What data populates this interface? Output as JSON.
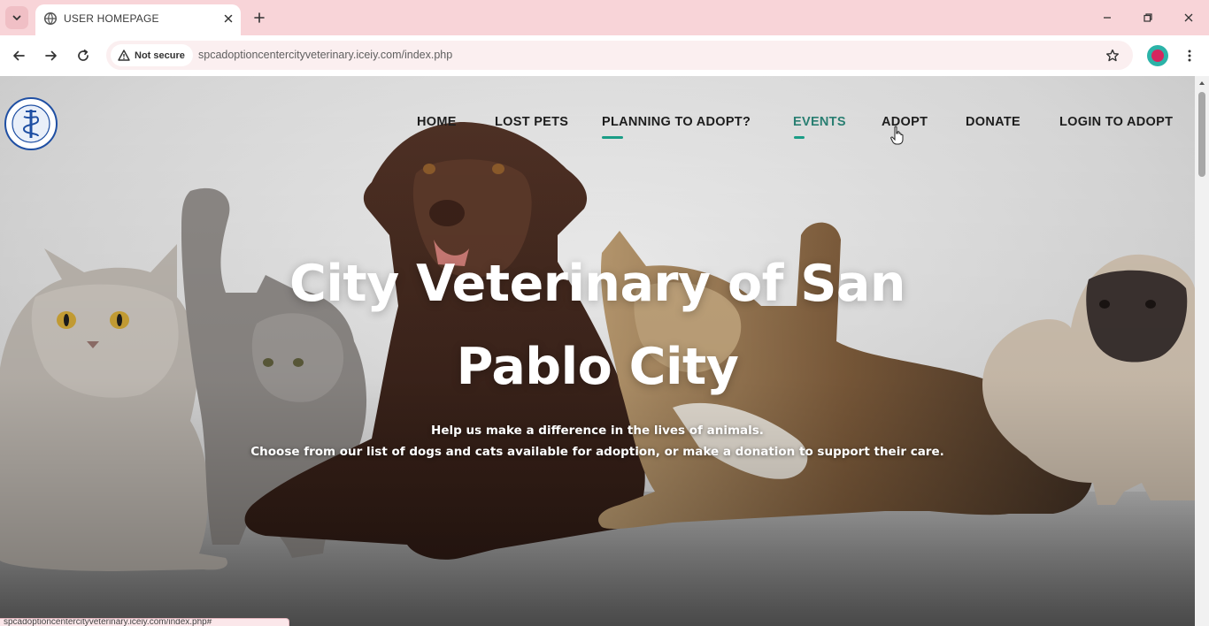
{
  "browser": {
    "tab": {
      "title": "USER HOMEPAGE"
    },
    "address_bar": {
      "security_label": "Not secure",
      "url": "spcadoptioncentercityveterinary.iceiy.com/index.php"
    },
    "status_bar_url": "spcadoptioncentercityveterinary.iceiy.com/index.php#"
  },
  "site": {
    "nav": {
      "items": [
        {
          "label": "HOME",
          "state": "default"
        },
        {
          "label": "LOST PETS",
          "state": "default"
        },
        {
          "label": "PLANNING TO ADOPT?",
          "state": "underlined"
        },
        {
          "label": "EVENTS",
          "state": "active"
        },
        {
          "label": "ADOPT",
          "state": "hover"
        },
        {
          "label": "DONATE",
          "state": "default"
        },
        {
          "label": "LOGIN TO ADOPT",
          "state": "default"
        }
      ],
      "accent_color": "#1a9d86"
    },
    "hero": {
      "title": "City Veterinary of San Pablo City",
      "subtitle_line1": "Help us make a difference in the lives of animals.",
      "subtitle_line2": "Choose from our list of dogs and cats available for adoption, or make a donation to support their care."
    }
  },
  "icons": {
    "tab_menu": "chevron-down-icon",
    "tab_favicon": "globe-icon",
    "tab_close": "close-icon",
    "new_tab": "plus-icon",
    "minimize": "minimize-icon",
    "restore": "restore-icon",
    "window_close": "close-icon",
    "back": "arrow-left-icon",
    "forward": "arrow-right-icon",
    "reload": "reload-icon",
    "warning": "warning-icon",
    "bookmark": "star-icon",
    "profile": "avatar-icon",
    "menu": "kebab-menu-icon",
    "logo": "veterinary-seal-logo"
  }
}
